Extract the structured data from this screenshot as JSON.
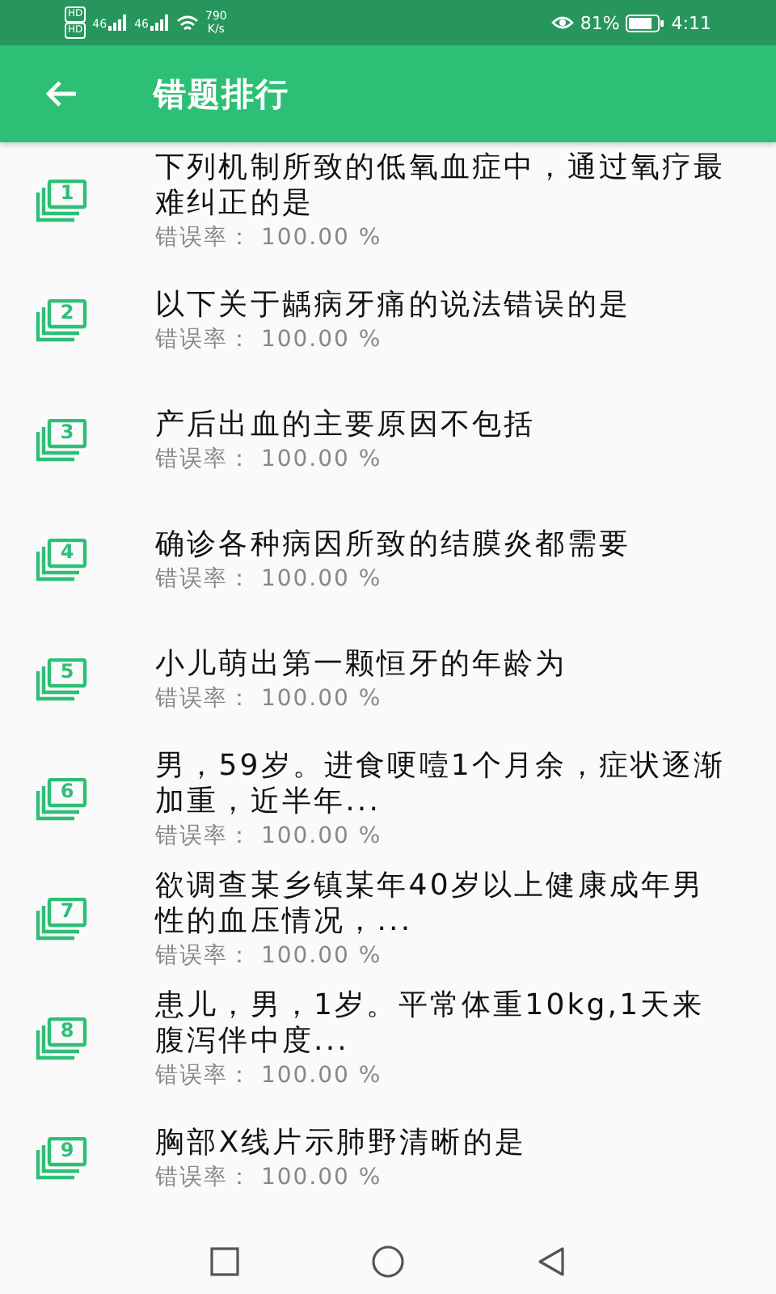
{
  "status_bar": {
    "sim_labels": [
      "HD",
      "HD"
    ],
    "networks": [
      "46",
      "46"
    ],
    "speed": "790",
    "speed_unit": "K/s",
    "battery": "81%",
    "time": "4:11"
  },
  "app_bar": {
    "title": "错题排行"
  },
  "items": [
    {
      "number": "1",
      "question": "下列机制所致的低氧血症中，通过氧疗最难纠正的是",
      "rate": "错误率： 100.00 %"
    },
    {
      "number": "2",
      "question": "以下关于龋病牙痛的说法错误的是",
      "rate": "错误率： 100.00 %"
    },
    {
      "number": "3",
      "question": "产后出血的主要原因不包括",
      "rate": "错误率： 100.00 %"
    },
    {
      "number": "4",
      "question": "确诊各种病因所致的结膜炎都需要",
      "rate": "错误率： 100.00 %"
    },
    {
      "number": "5",
      "question": "小儿萌出第一颗恒牙的年龄为",
      "rate": "错误率： 100.00 %"
    },
    {
      "number": "6",
      "question": "男，59岁。进食哽噎1个月余，症状逐渐加重，近半年...",
      "rate": "错误率： 100.00 %"
    },
    {
      "number": "7",
      "question": "欲调查某乡镇某年40岁以上健康成年男性的血压情况，...",
      "rate": "错误率： 100.00 %"
    },
    {
      "number": "8",
      "question": "患儿，男，1岁。平常体重10kg,1天来腹泻伴中度...",
      "rate": "错误率： 100.00 %"
    },
    {
      "number": "9",
      "question": "胸部X线片示肺野清晰的是",
      "rate": "错误率： 100.00 %"
    }
  ]
}
